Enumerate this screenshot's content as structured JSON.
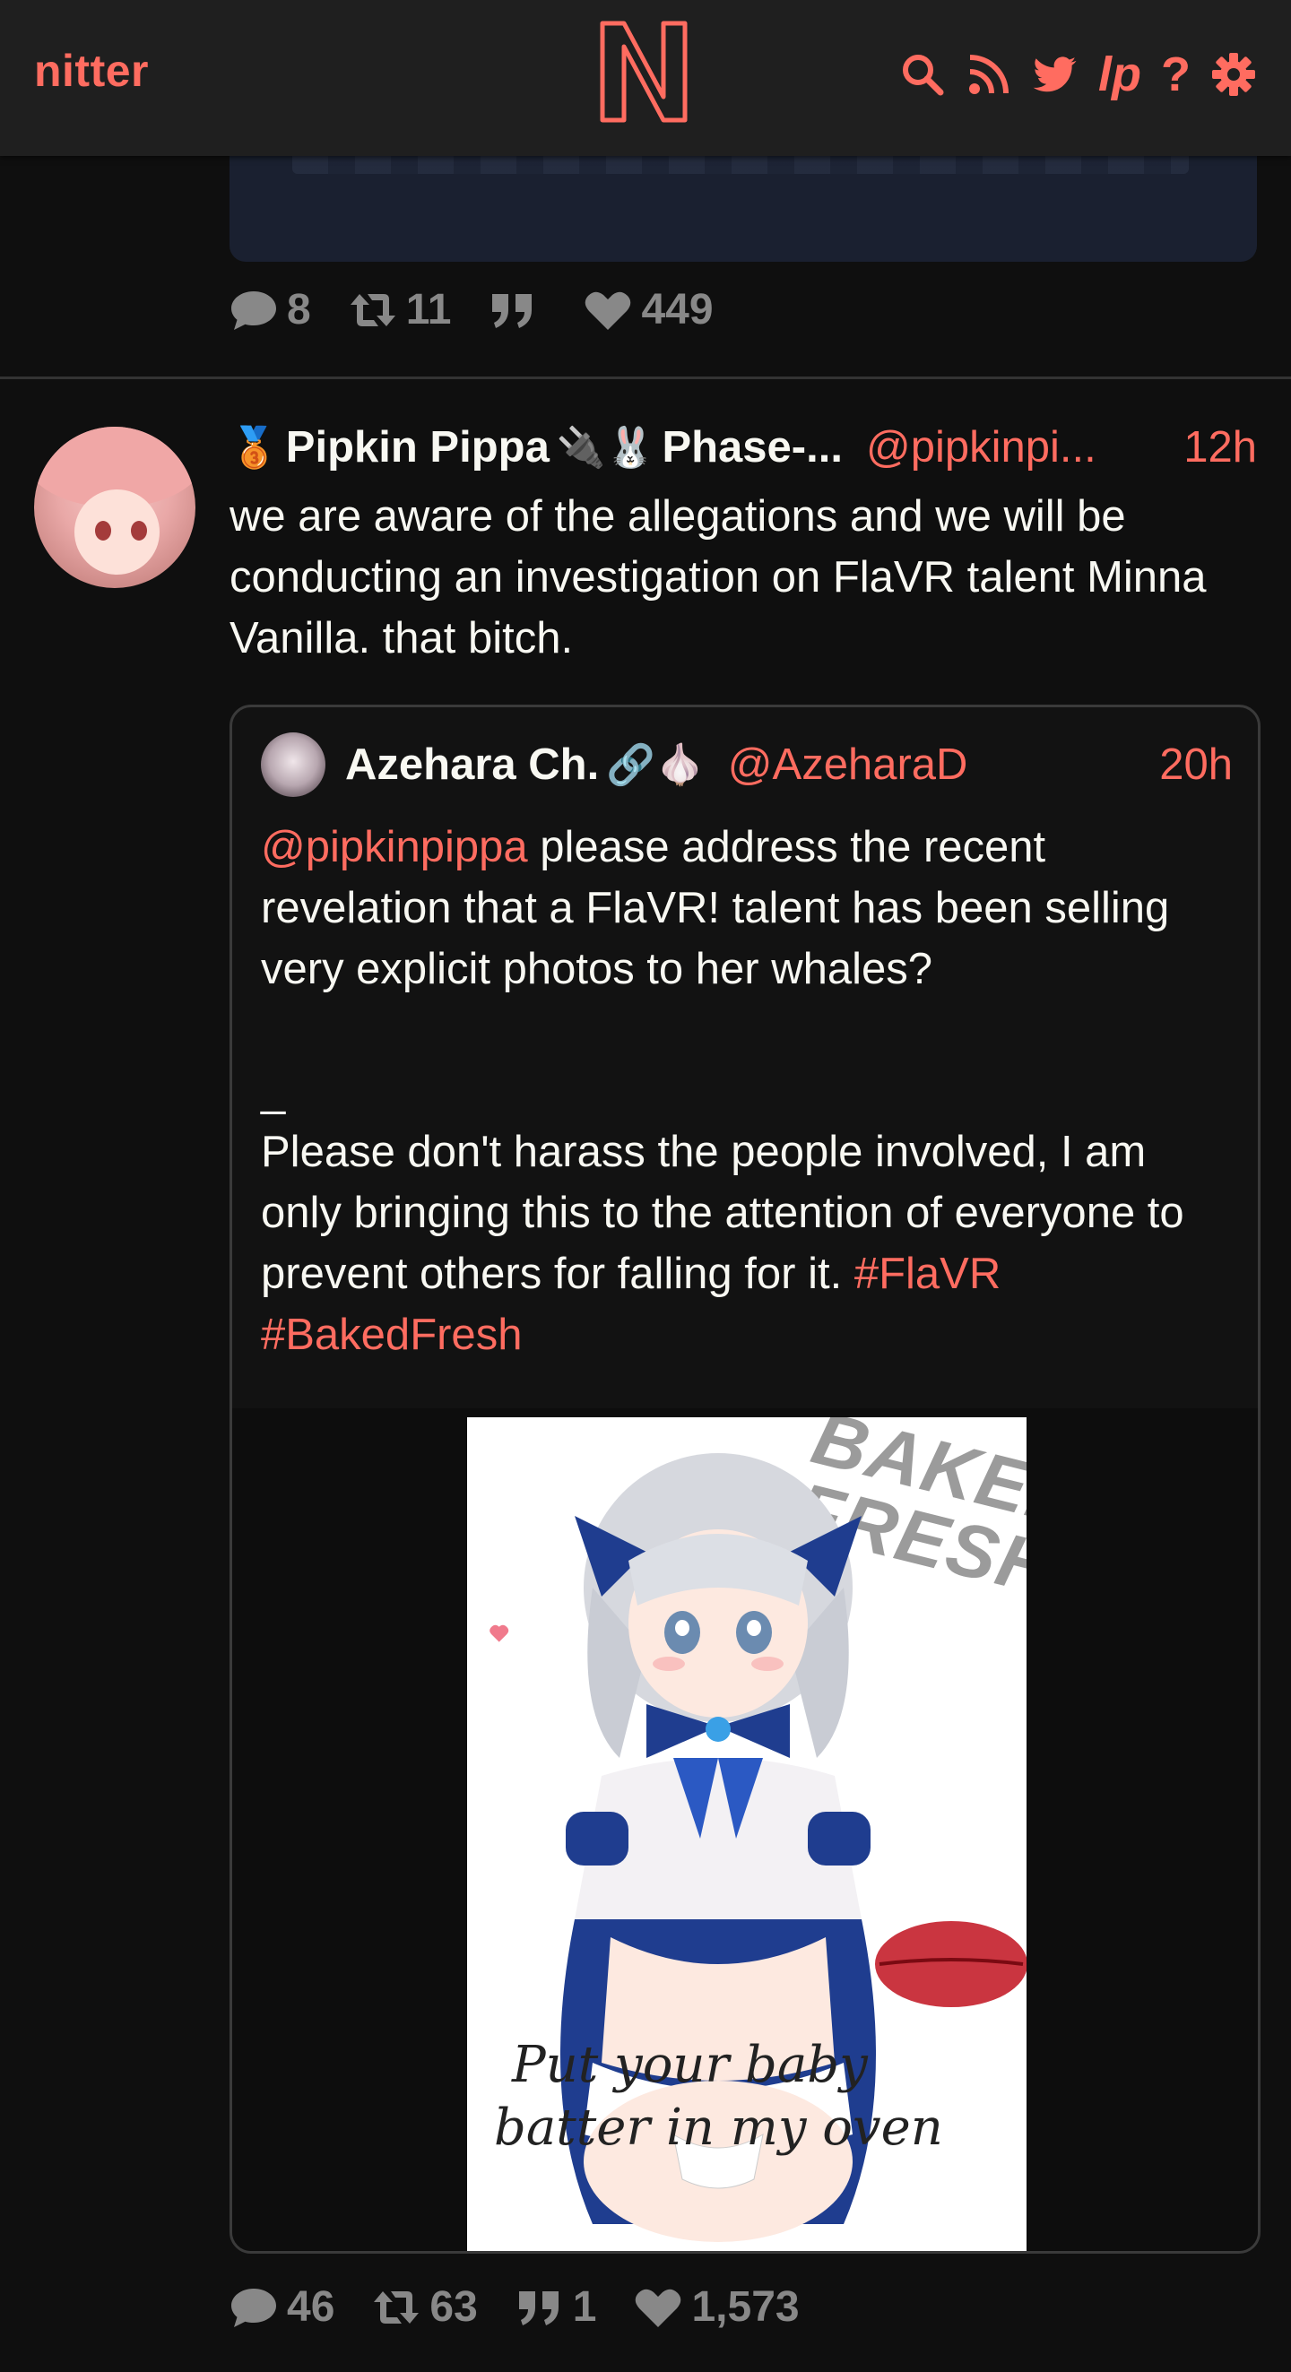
{
  "nav": {
    "brand": "nitter",
    "icons": [
      "search-icon",
      "rss-icon",
      "twitter-icon",
      "lp-icon",
      "help-icon",
      "settings-icon"
    ],
    "lp_label": "lp",
    "help_label": "?"
  },
  "prev_tweet": {
    "stats": {
      "replies": "8",
      "retweets": "11",
      "quotes": "",
      "likes": "449"
    }
  },
  "tweet": {
    "fullname": "Pipkin Pippa",
    "name_emoji_1": "🥉",
    "name_emoji_2": "🔌🐰",
    "name_suffix": "Phase-...",
    "handle": "@pipkinpi...",
    "time": "12h",
    "text": "we are aware of the allegations and we will be conducting an investigation on FlaVR talent Minna Vanilla. that bitch.",
    "stats": {
      "replies": "46",
      "retweets": "63",
      "quotes": "1",
      "likes": "1,573"
    }
  },
  "quote": {
    "fullname": "Azehara Ch.",
    "name_emoji": "🔗🧄",
    "handle": "@AzeharaD",
    "time": "20h",
    "mention": "@pipkinpippa",
    "text_1": " please address the recent revelation that a FlaVR! talent has been selling very explicit photos to her whales?",
    "text_2": "\n\n_\nPlease don't harass the people involved, I am only bringing this to the attention of everyone to prevent others for falling for it. ",
    "hashtag_1": "#FlaVR",
    "hashtag_2": "#BakedFresh",
    "image": {
      "watermark": "BAKED FRESH",
      "caption_line_1": "Put your baby",
      "caption_line_2": "batter in my oven"
    }
  },
  "colors": {
    "accent": "#ff6c60",
    "bg": "#0f0f0f",
    "nav_bg": "#1f1f1f",
    "muted": "#888888"
  }
}
